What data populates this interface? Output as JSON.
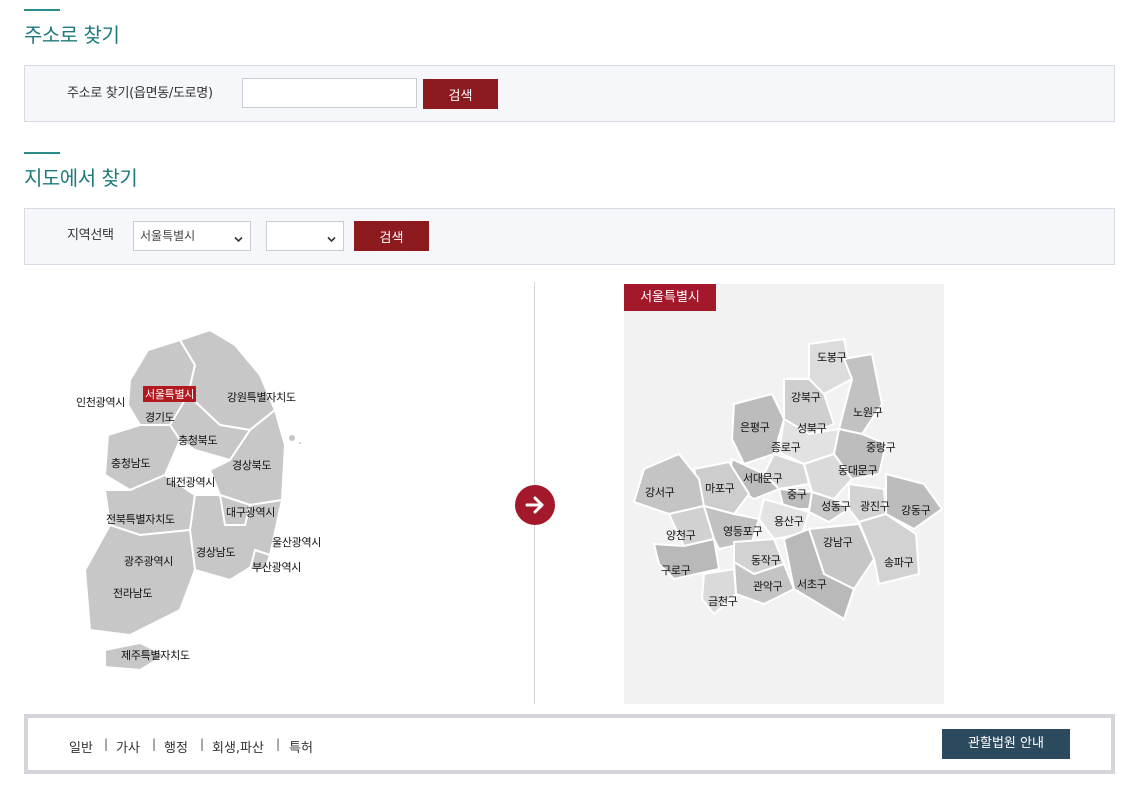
{
  "address_section": {
    "title": "주소로 찾기",
    "label": "주소로 찾기(읍면동/도로명)",
    "input_value": "",
    "search_label": "검색"
  },
  "map_section": {
    "title": "지도에서 찾기",
    "label": "지역선택",
    "region_selected": "서울특별시",
    "district_selected": "",
    "search_label": "검색"
  },
  "korea_map": {
    "regions": {
      "seoul": "서울특별시",
      "incheon": "인천광역시",
      "gangwon": "강원특별자치도",
      "gyeonggi": "경기도",
      "chungbuk": "충청북도",
      "chungnam": "충청남도",
      "gyeongbuk": "경상북도",
      "daejeon": "대전광역시",
      "daegu": "대구광역시",
      "jeonbuk": "전북특별자치도",
      "ulsan": "울산광역시",
      "gwangju": "광주광역시",
      "gyeongnam": "경상남도",
      "busan": "부산광역시",
      "jeonnam": "전라남도",
      "jeju": "제주특별자치도"
    }
  },
  "seoul_map": {
    "tag": "서울특별시",
    "districts": {
      "dobong": "도봉구",
      "gangbuk": "강북구",
      "nowon": "노원구",
      "eunpyeong": "은평구",
      "seongbuk": "성북구",
      "jongno": "종로구",
      "jungnang": "중랑구",
      "dongdaemun": "동대문구",
      "seodaemun": "서대문구",
      "gangseo": "강서구",
      "mapo": "마포구",
      "jung": "중구",
      "seongdong": "성동구",
      "gwangjin": "광진구",
      "gangdong": "강동구",
      "yongsan": "용산구",
      "yangcheon": "양천구",
      "yeongdeungpo": "영등포구",
      "gangnam": "강남구",
      "dongjak": "동작구",
      "songpa": "송파구",
      "guro": "구로구",
      "gwanak": "관악구",
      "seocho": "서초구",
      "geumcheon": "금천구"
    }
  },
  "case_types": [
    "일반",
    "가사",
    "행정",
    "회생,파산",
    "특허"
  ],
  "separator": "|",
  "court_button": "관할법원 안내",
  "colors": {
    "accent_teal": "#1f7a7f",
    "button_red": "#8c1a1f",
    "tag_red": "#a3182a",
    "button_navy": "#2c4a5e"
  },
  "icons": {
    "arrow": "arrow-right-circle-icon",
    "select_caret": "chevron-down-icon"
  }
}
